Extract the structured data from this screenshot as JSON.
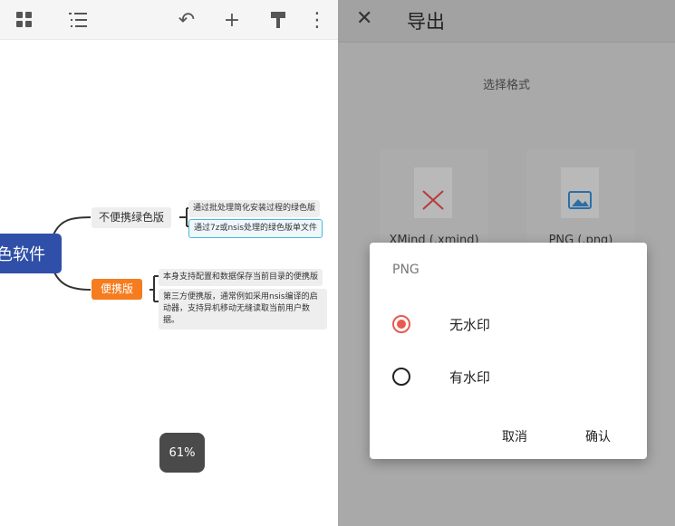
{
  "toolbar": {
    "icons": [
      "grid-icon",
      "list-icon",
      "undo-icon",
      "add-icon",
      "format-painter-icon",
      "more-icon"
    ]
  },
  "mindmap": {
    "central": "色软件",
    "branches": [
      {
        "label": "不便携绿色版",
        "children": [
          "通过批处理简化安装过程的绿色版",
          "通过7z或nsis处理的绿色版单文件"
        ]
      },
      {
        "label": "便携版",
        "children": [
          "本身支持配置和数据保存当前目录的便携版",
          "第三方便携版，通常例如采用nsis编译的启动器，支持异机移动无缝读取当前用户数据。"
        ]
      }
    ],
    "zoom": "61%"
  },
  "export": {
    "title": "导出",
    "subtitle": "选择格式",
    "formats": [
      "XMind (.xmind)",
      "PNG (.png)"
    ]
  },
  "dialog": {
    "title": "PNG",
    "options": [
      "无水印",
      "有水印"
    ],
    "selected": 0,
    "cancel": "取消",
    "confirm": "确认"
  },
  "colors": {
    "central": "#2f4fa8",
    "portable": "#f57c1f",
    "radio": "#e85a4f"
  }
}
